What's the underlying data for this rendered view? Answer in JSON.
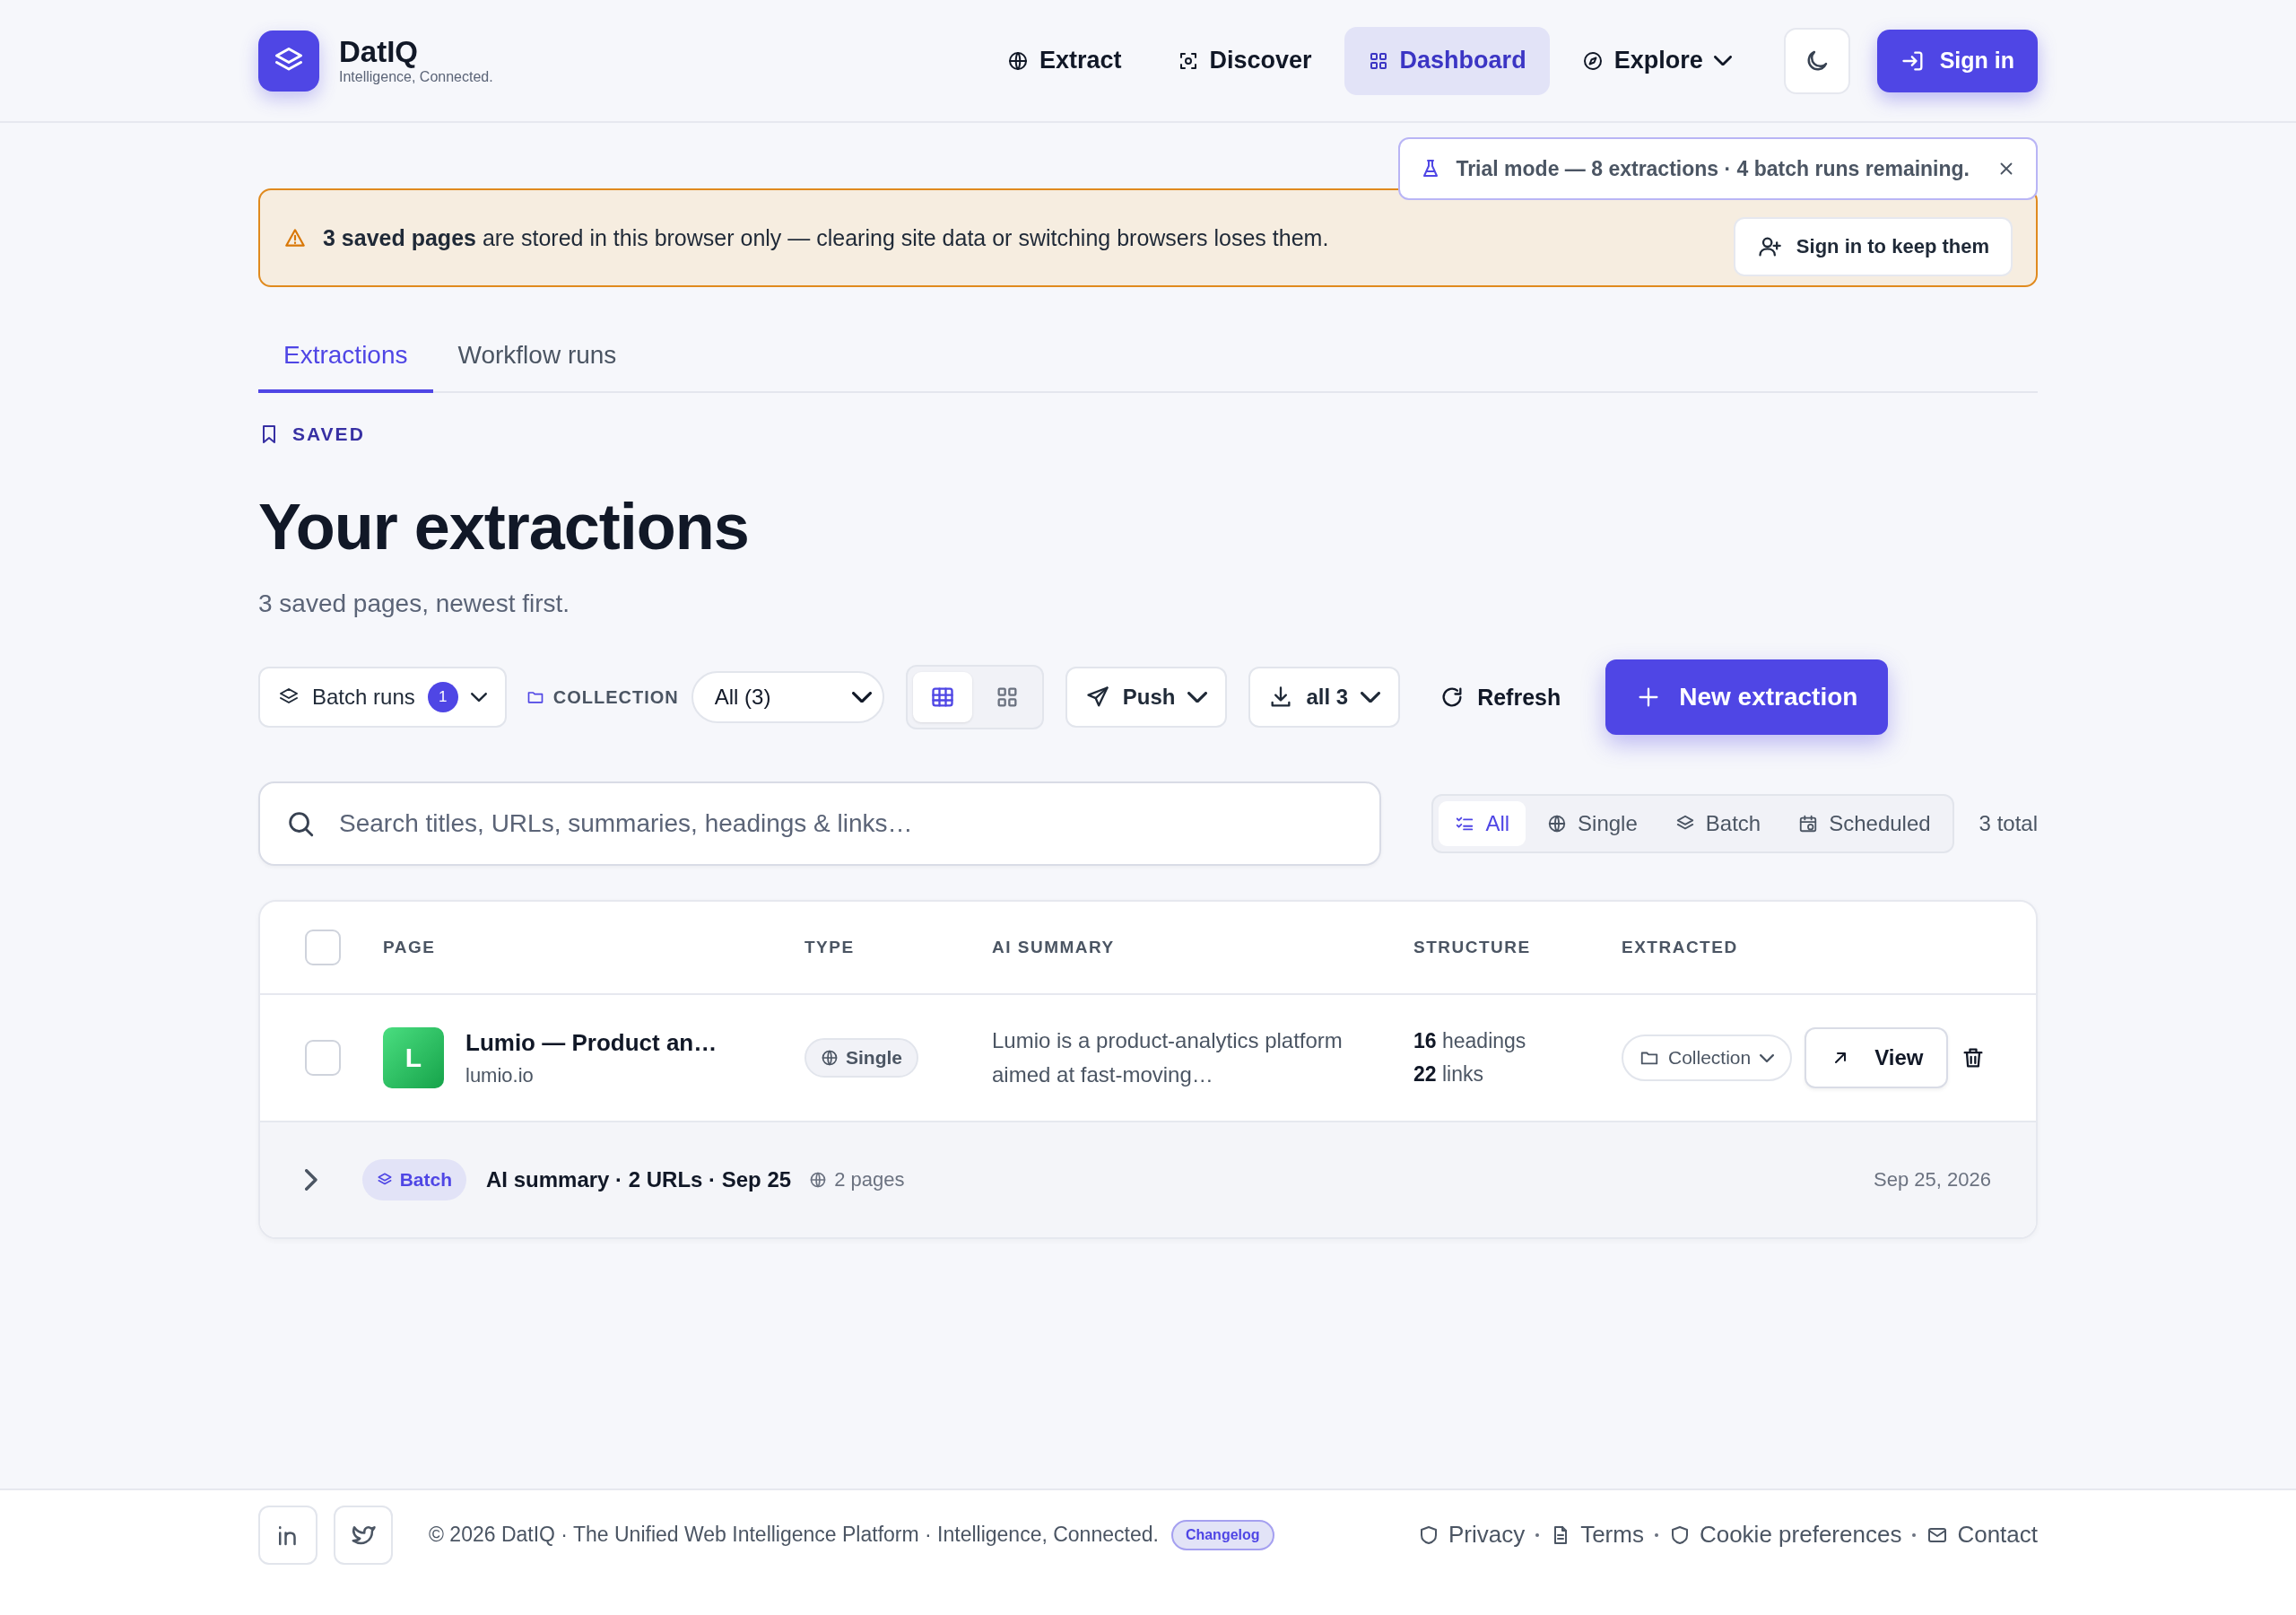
{
  "brand": {
    "name": "DatIQ",
    "tagline": "Intelligence, Connected."
  },
  "nav": [
    {
      "label": "Extract",
      "kind": "link",
      "selected": false
    },
    {
      "label": "Discover",
      "kind": "link",
      "selected": false
    },
    {
      "label": "Dashboard",
      "kind": "link",
      "selected": true
    },
    {
      "label": "Explore",
      "kind": "menu",
      "selected": false
    }
  ],
  "sign_in": "Sign in",
  "trial_toast": {
    "text": "Trial mode — 8 extractions · 4 batch runs remaining."
  },
  "warning_banner": {
    "text": "**3 saved pages** are stored in this browser only — clearing site data or switching browsers loses them.",
    "button": "Sign in to keep them"
  },
  "tabs": [
    {
      "label": "Extractions",
      "selected": true
    },
    {
      "label": "Workflow runs",
      "selected": false
    }
  ],
  "eyebrow": "SAVED",
  "title": "Your extractions",
  "subtitle": "3 saved pages, newest first.",
  "toolbar": {
    "batch_runs": {
      "label": "Batch runs",
      "count": "1"
    },
    "collection_label": "COLLECTION",
    "collection_value": "All (3)",
    "views": [
      {
        "kind": "table",
        "selected": true
      },
      {
        "kind": "grid",
        "selected": false
      }
    ],
    "push": "Push",
    "download": "all 3",
    "refresh": "Refresh",
    "new_extraction": "New extraction"
  },
  "search": {
    "placeholder": "Search titles, URLs, summaries, headings & links…"
  },
  "filters": [
    {
      "label": "All",
      "selected": true
    },
    {
      "label": "Single",
      "selected": false
    },
    {
      "label": "Batch",
      "selected": false
    },
    {
      "label": "Scheduled",
      "selected": false
    }
  ],
  "total": "3 total",
  "table": {
    "select_all_checked": false,
    "columns": [
      "PAGE",
      "TYPE",
      "AI SUMMARY",
      "STRUCTURE",
      "EXTRACTED"
    ],
    "rows": [
      {
        "checked": false,
        "initial": "L",
        "title": "Lumio — Product an…",
        "domain": "lumio.io",
        "type": "Single",
        "summary": "Lumio is a product-analytics platform aimed at fast-moving…",
        "headings": "**16** headings",
        "links": "**22** links",
        "collection": "Collection",
        "view": "View"
      }
    ],
    "groups": [
      {
        "expanded": false,
        "tag": "Batch",
        "title": "AI summary · 2 URLs · Sep 25",
        "pages": "2 pages",
        "date": "Sep 25, 2026"
      }
    ]
  },
  "footer": {
    "copyright": "© 2026 DatIQ · The Unified Web Intelligence Platform · Intelligence, Connected.",
    "badge": "Changelog",
    "links": [
      "Privacy",
      "Terms",
      "Cookie preferences",
      "Contact"
    ]
  }
}
